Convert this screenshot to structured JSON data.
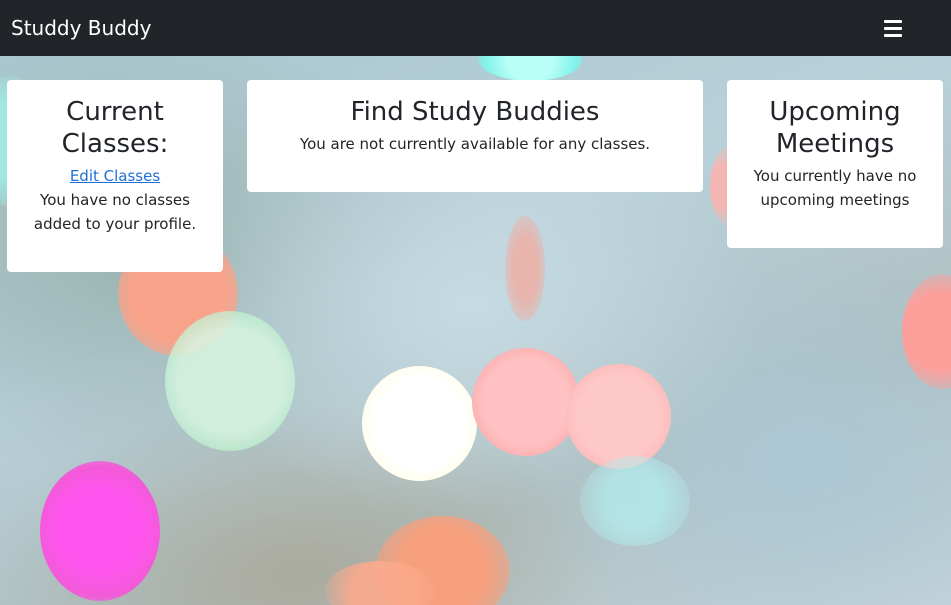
{
  "navbar": {
    "brand": "Studdy Buddy",
    "menu_icon": "hamburger-menu-icon"
  },
  "cards": {
    "classes": {
      "title": "Current Classes:",
      "link": "Edit Classes",
      "text": "You have no classes added to your profile."
    },
    "find": {
      "title": "Find Study Buddies",
      "text": "You are not currently available for any classes."
    },
    "meetings": {
      "title": "Upcoming Meetings",
      "text": "You currently have no upcoming meetings"
    }
  },
  "colors": {
    "navbar_bg": "#212529",
    "card_bg": "#ffffff",
    "link": "#1f6fd6",
    "text": "#212529"
  }
}
